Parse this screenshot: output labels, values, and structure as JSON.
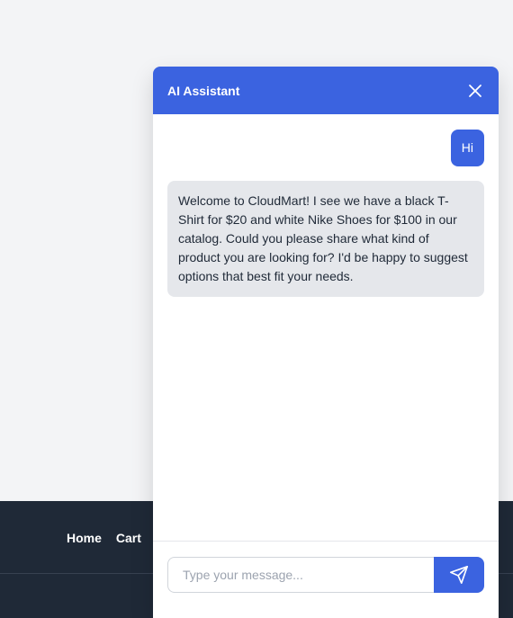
{
  "footer": {
    "links": [
      {
        "label": "Home"
      },
      {
        "label": "Cart"
      }
    ]
  },
  "chat": {
    "title": "AI Assistant",
    "icons": {
      "close": "close-icon",
      "send": "send-icon"
    },
    "colors": {
      "accent": "#3b63e0",
      "bot_bubble": "#e5e7eb",
      "footer": "#1f2937"
    },
    "messages": [
      {
        "role": "user",
        "text": "Hi"
      },
      {
        "role": "assistant",
        "text": "Welcome to CloudMart! I see we have a black T-Shirt for $20 and white Nike Shoes for $100 in our catalog. Could you please share what kind of product you are looking for? I'd be happy to suggest options that best fit your needs."
      }
    ],
    "input": {
      "value": "",
      "placeholder": "Type your message..."
    }
  }
}
